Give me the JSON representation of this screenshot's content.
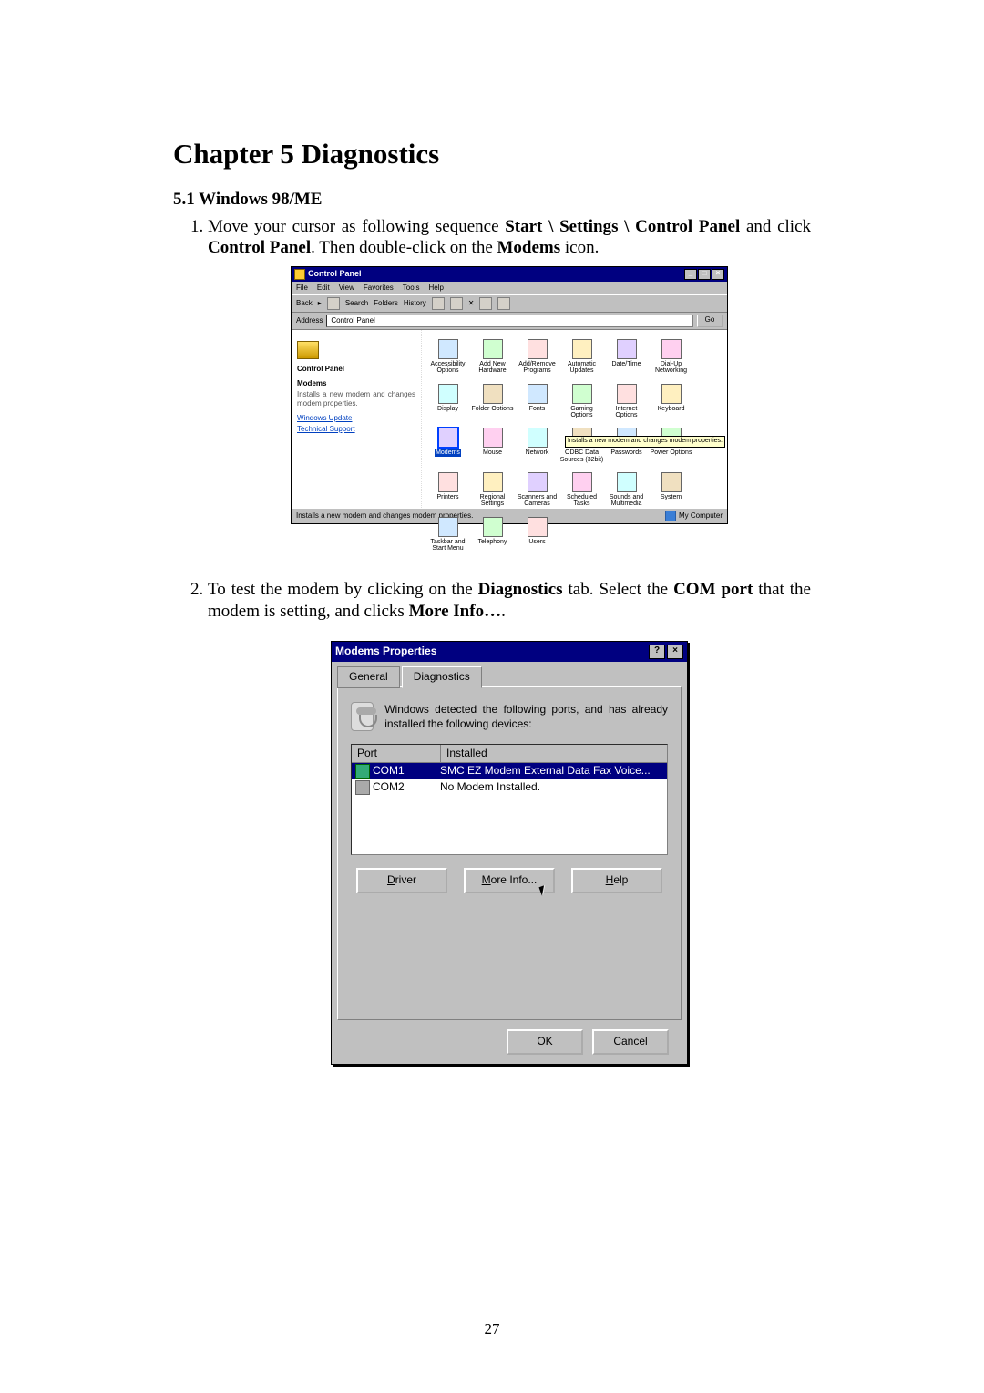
{
  "chapter_title": "Chapter 5 Diagnostics",
  "section_title": "5.1 Windows 98/ME",
  "step1": {
    "pre": "Move your cursor as following sequence ",
    "b1": "Start \\ Settings \\ Control Panel",
    "mid": " and click ",
    "b2": "Control Panel",
    "post1": ".   Then double-click on the ",
    "b3": "Modems",
    "post2": " icon."
  },
  "step2": {
    "pre": "To test the modem by clicking on the ",
    "b1": "Diagnostics",
    "mid1": " tab.  Select the ",
    "b2": "COM port",
    "mid2": " that the modem is setting, and clicks ",
    "b3": "More Info…",
    "post": "."
  },
  "page_number": "27",
  "cp": {
    "title": "Control Panel",
    "menu": {
      "file": "File",
      "edit": "Edit",
      "view": "View",
      "favorites": "Favorites",
      "tools": "Tools",
      "help": "Help"
    },
    "toolbar": {
      "back": "Back",
      "search": "Search",
      "folders": "Folders",
      "history": "History"
    },
    "address_label": "Address",
    "address_value": "Control Panel",
    "go": "Go",
    "side": {
      "title": "Control Panel",
      "item_head": "Modems",
      "item_desc": "Installs a new modem and changes modem properties.",
      "link1": "Windows Update",
      "link2": "Technical Support"
    },
    "icons": {
      "accessibility": "Accessibility Options",
      "addremovehw": "Add New Hardware",
      "addremoveprog": "Add/Remove Programs",
      "autoupd": "Automatic Updates",
      "datetime": "Date/Time",
      "dialup": "Dial-Up Networking",
      "display": "Display",
      "folderopts": "Folder Options",
      "fonts": "Fonts",
      "gaming": "Gaming Options",
      "internet": "Internet Options",
      "keyboard": "Keyboard",
      "modems": "Modems",
      "mouse": "Mouse",
      "network": "Network",
      "odbc": "ODBC Data Sources (32bit)",
      "passwords": "Passwords",
      "power": "Power Options",
      "printers": "Printers",
      "regional": "Regional Settings",
      "scanners": "Scanners and Cameras",
      "schedtasks": "Scheduled Tasks",
      "sounds": "Sounds and Multimedia",
      "system": "System",
      "taskbar": "Taskbar and Start Menu",
      "telephony": "Telephony",
      "users": "Users"
    },
    "tooltip": "Installs a new modem and changes modem properties.",
    "status_left": "Installs a new modem and changes modem properties.",
    "status_right": "My Computer"
  },
  "dlg": {
    "title": "Modems Properties",
    "tab_general": "General",
    "tab_diag": "Diagnostics",
    "detect_text": "Windows detected the following ports, and has already installed the following devices:",
    "hdr_port": "Port",
    "hdr_installed": "Installed",
    "row1_port": "COM1",
    "row1_inst": "SMC EZ Modem External Data Fax Voice...",
    "row2_port": "COM2",
    "row2_inst": "No Modem Installed.",
    "btn_driver_u": "D",
    "btn_driver_rest": "river",
    "btn_more_u": "M",
    "btn_more_rest": "ore Info...",
    "btn_help_u": "H",
    "btn_help_rest": "elp",
    "btn_ok": "OK",
    "btn_cancel": "Cancel"
  }
}
